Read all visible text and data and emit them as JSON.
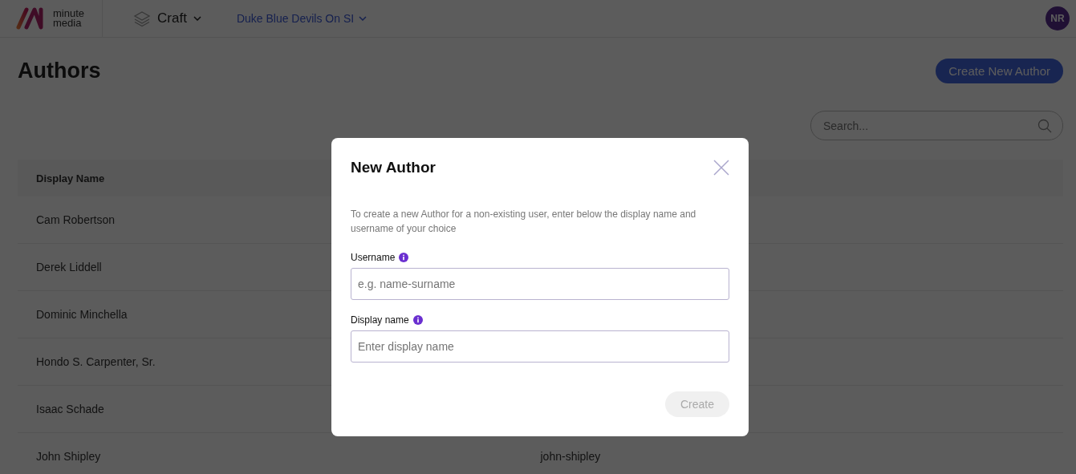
{
  "topbar": {
    "logo_text": [
      "minute",
      "media"
    ],
    "product": "Craft",
    "site": "Duke Blue Devils On SI",
    "avatar": "NR"
  },
  "page": {
    "title": "Authors",
    "create_button": "Create New Author",
    "search": {
      "placeholder": "Search..."
    }
  },
  "table": {
    "columns": [
      "Display Name"
    ],
    "rows": [
      {
        "display_name": "Cam Robertson"
      },
      {
        "display_name": "Derek Liddell"
      },
      {
        "display_name": "Dominic Minchella"
      },
      {
        "display_name": "Hondo S. Carpenter, Sr."
      },
      {
        "display_name": "Isaac Schade"
      },
      {
        "display_name": "John Shipley",
        "username": "john-shipley"
      }
    ]
  },
  "dialog": {
    "title": "New Author",
    "description": "To create a new Author for a non-existing user, enter below the display name and username of your choice",
    "fields": [
      {
        "label": "Username",
        "placeholder": "e.g. name-surname"
      },
      {
        "label": "Display name",
        "placeholder": "Enter display name"
      }
    ],
    "submit": {
      "label": "Create",
      "disabled": true
    }
  }
}
